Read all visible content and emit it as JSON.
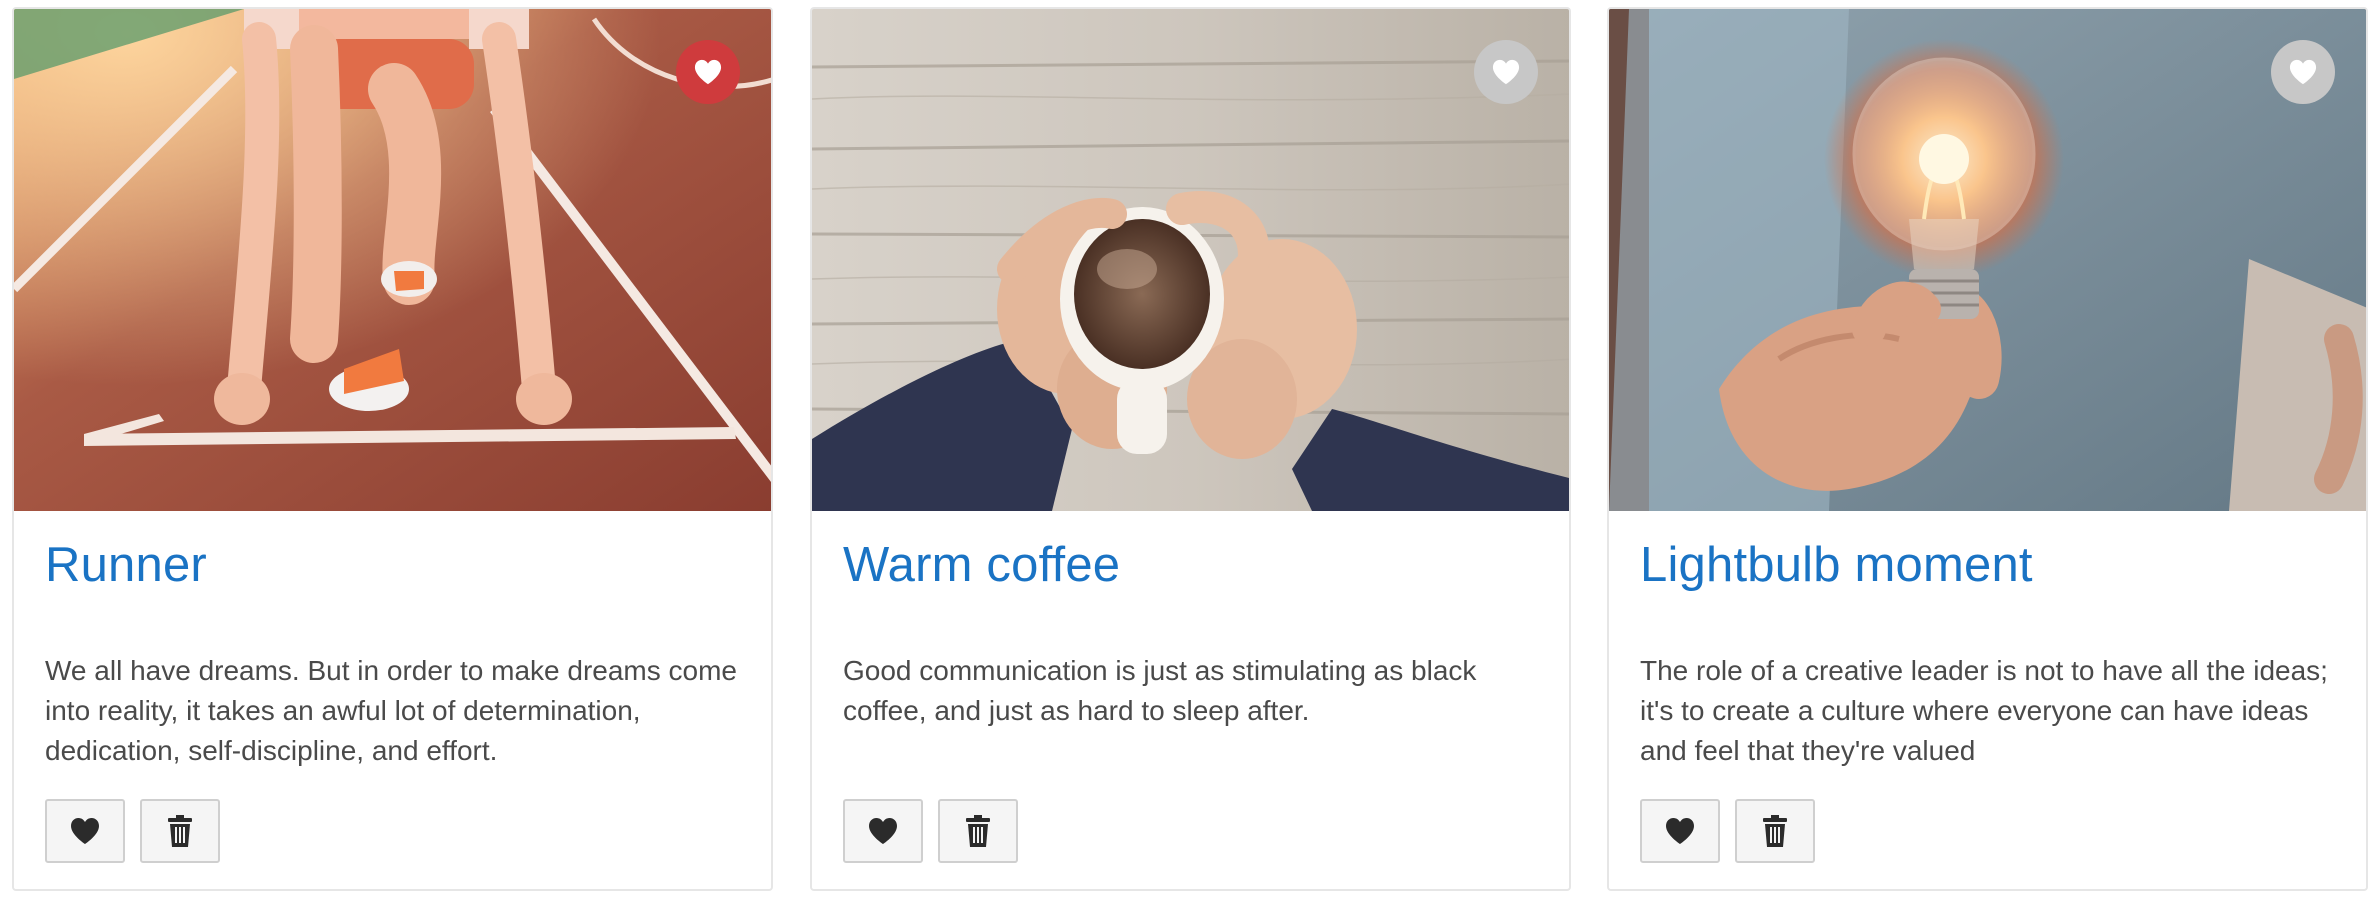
{
  "cards": [
    {
      "title": "Runner",
      "description": "We all have dreams. But in order to make dreams come into reality, it takes an awful lot of determination, dedication, self-discipline, and effort.",
      "favorited": true,
      "image_icon": "runner-photo",
      "like_icon": "heart-icon",
      "delete_icon": "trash-icon"
    },
    {
      "title": "Warm coffee",
      "description": "Good communication is just as stimulating as black coffee, and just as hard to sleep after.",
      "favorited": false,
      "image_icon": "coffee-photo",
      "like_icon": "heart-icon",
      "delete_icon": "trash-icon"
    },
    {
      "title": "Lightbulb moment",
      "description": "The role of a creative leader is not to have all the ideas; it's to create a culture where everyone can have ideas and feel that they're valued",
      "favorited": false,
      "image_icon": "lightbulb-photo",
      "like_icon": "heart-icon",
      "delete_icon": "trash-icon"
    }
  ],
  "colors": {
    "title": "#1a73c4",
    "favorite_active": "#cf3b3d",
    "favorite_inactive": "#c7c7c7",
    "text": "#4a4a4a"
  }
}
